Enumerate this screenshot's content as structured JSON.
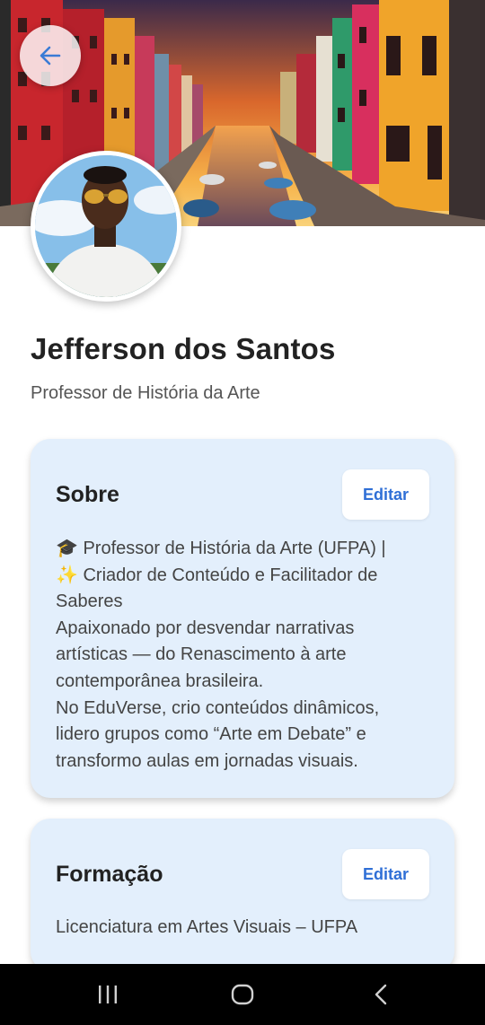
{
  "profile": {
    "name": "Jefferson dos Santos",
    "role": "Professor de História da Arte"
  },
  "about": {
    "title": "Sobre",
    "edit_label": "Editar",
    "lines": [
      "🎓 Professor de História da Arte (UFPA) |",
      "✨ Criador de Conteúdo e Facilitador de",
      "Saberes",
      "Apaixonado por desvendar narrativas",
      "artísticas — do Renascimento à arte",
      "contemporânea brasileira.",
      "No EduVerse, crio conteúdos dinâmicos,",
      "lidero grupos como “Arte em Debate” e",
      "transformo aulas em jornadas visuais."
    ]
  },
  "education": {
    "title": "Formação",
    "edit_label": "Editar",
    "text": "Licenciatura em Artes Visuais – UFPA"
  },
  "icons": {
    "back": "arrow-left-icon",
    "nav_recents": "recents-icon",
    "nav_home": "home-icon",
    "nav_back": "back-chevron-icon"
  },
  "colors": {
    "accent": "#2f6fd6",
    "card_background": "#e3effc"
  }
}
